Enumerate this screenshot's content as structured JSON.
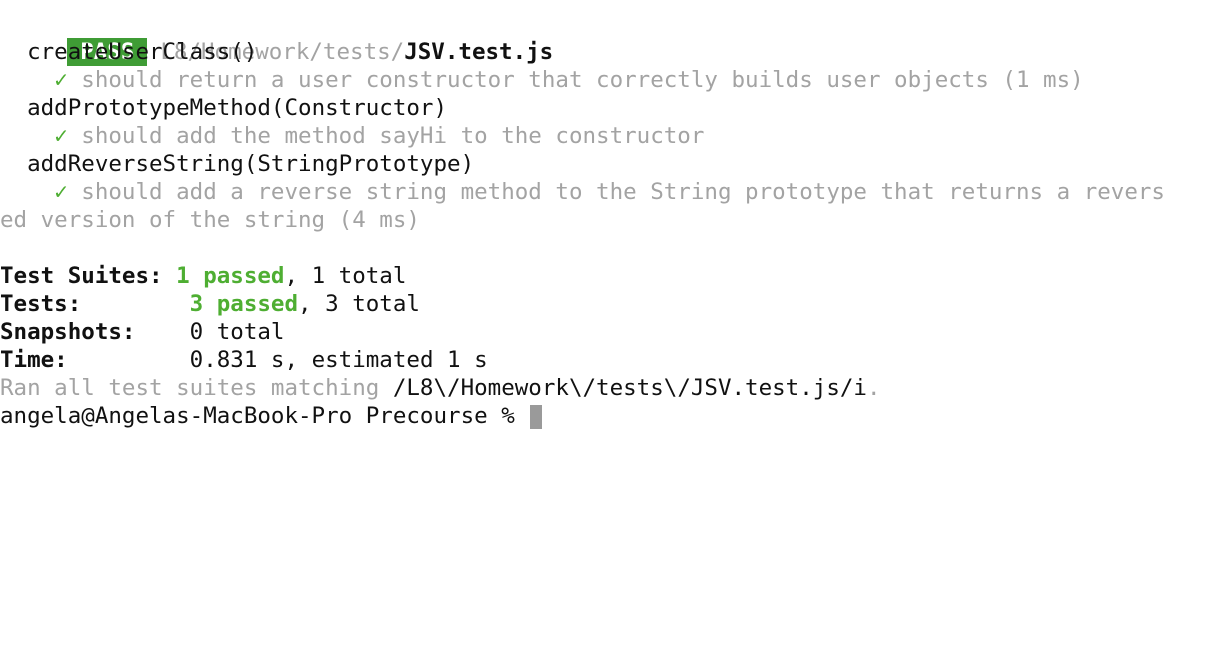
{
  "header": {
    "badge": "PASS",
    "path_dim": "L8/Homework/tests/",
    "file": "JSV.test.js"
  },
  "suites": [
    {
      "name": "createUserClass()",
      "tests": [
        {
          "check": "✓",
          "text": "should return a user constructor that correctly builds user objects (1 ms)"
        }
      ]
    },
    {
      "name": "addPrototypeMethod(Constructor)",
      "tests": [
        {
          "check": "✓",
          "text": "should add the method sayHi to the constructor"
        }
      ]
    },
    {
      "name": "addReverseString(StringPrototype)",
      "tests": [
        {
          "check": "✓",
          "text": "should add a reverse string method to the String prototype that returns a revers",
          "wrap": "ed version of the string (4 ms)"
        }
      ]
    }
  ],
  "summary": {
    "suites_label": "Test Suites:",
    "suites_passed": "1 passed",
    "suites_total": ", 1 total",
    "tests_label": "Tests:",
    "tests_passed": "3 passed",
    "tests_total": ", 3 total",
    "snapshots_label": "Snapshots:",
    "snapshots_value": "0 total",
    "time_label": "Time:",
    "time_value": "0.831 s, estimated 1 s"
  },
  "ran": {
    "prefix": "Ran all test suites matching ",
    "pattern": "/L8\\/Homework\\/tests\\/JSV.test.js/i",
    "suffix": "."
  },
  "prompt": {
    "text": "angela@Angelas-MacBook-Pro Precourse % "
  },
  "colors": {
    "pass_badge": "#3f9c35",
    "green": "#4eae32",
    "dim": "#a3a3a3"
  }
}
